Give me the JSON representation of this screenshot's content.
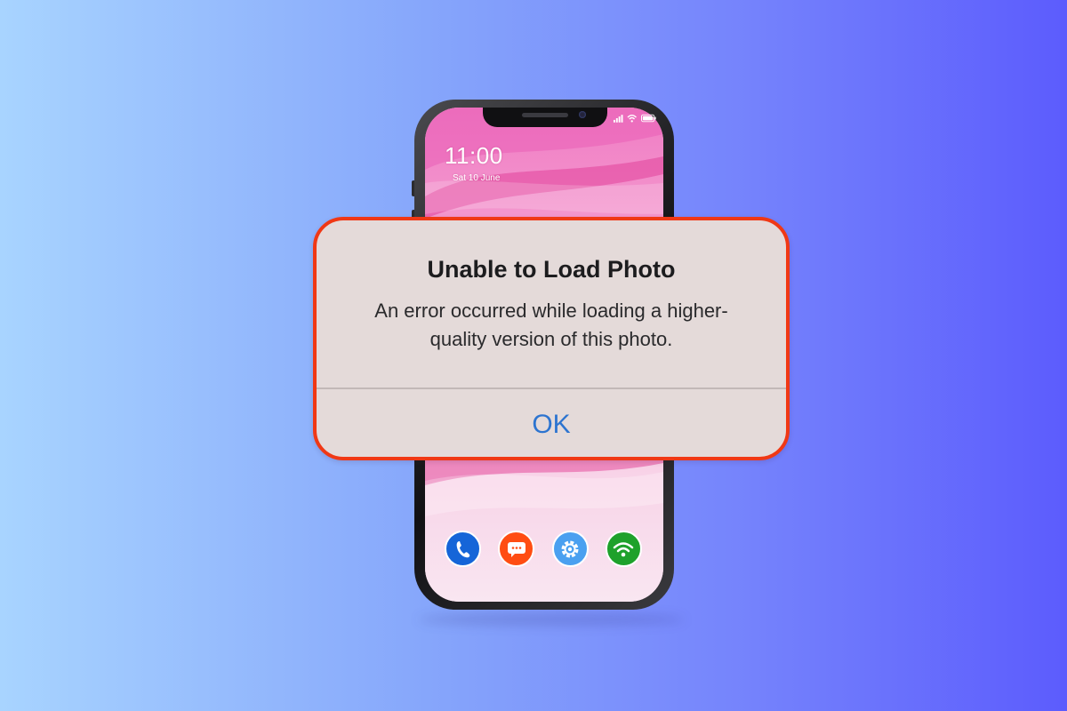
{
  "lock_screen": {
    "time": "11:00",
    "date": "Sat 10 June"
  },
  "status_bar": {
    "icons": [
      "signal-icon",
      "wifi-icon",
      "battery-icon"
    ]
  },
  "dock": {
    "apps": [
      {
        "name": "phone-app-icon",
        "color": "#1565d8"
      },
      {
        "name": "messages-app-icon",
        "color": "#ff4d12"
      },
      {
        "name": "settings-app-icon",
        "color": "#4aa0f0"
      },
      {
        "name": "wifi-app-icon",
        "color": "#1ea12b"
      }
    ]
  },
  "alert": {
    "title": "Unable to Load Photo",
    "message": "An error occurred while loading a higher-quality version of this photo.",
    "ok_label": "OK",
    "border_color": "#f03815",
    "button_color": "#2d74d0"
  }
}
